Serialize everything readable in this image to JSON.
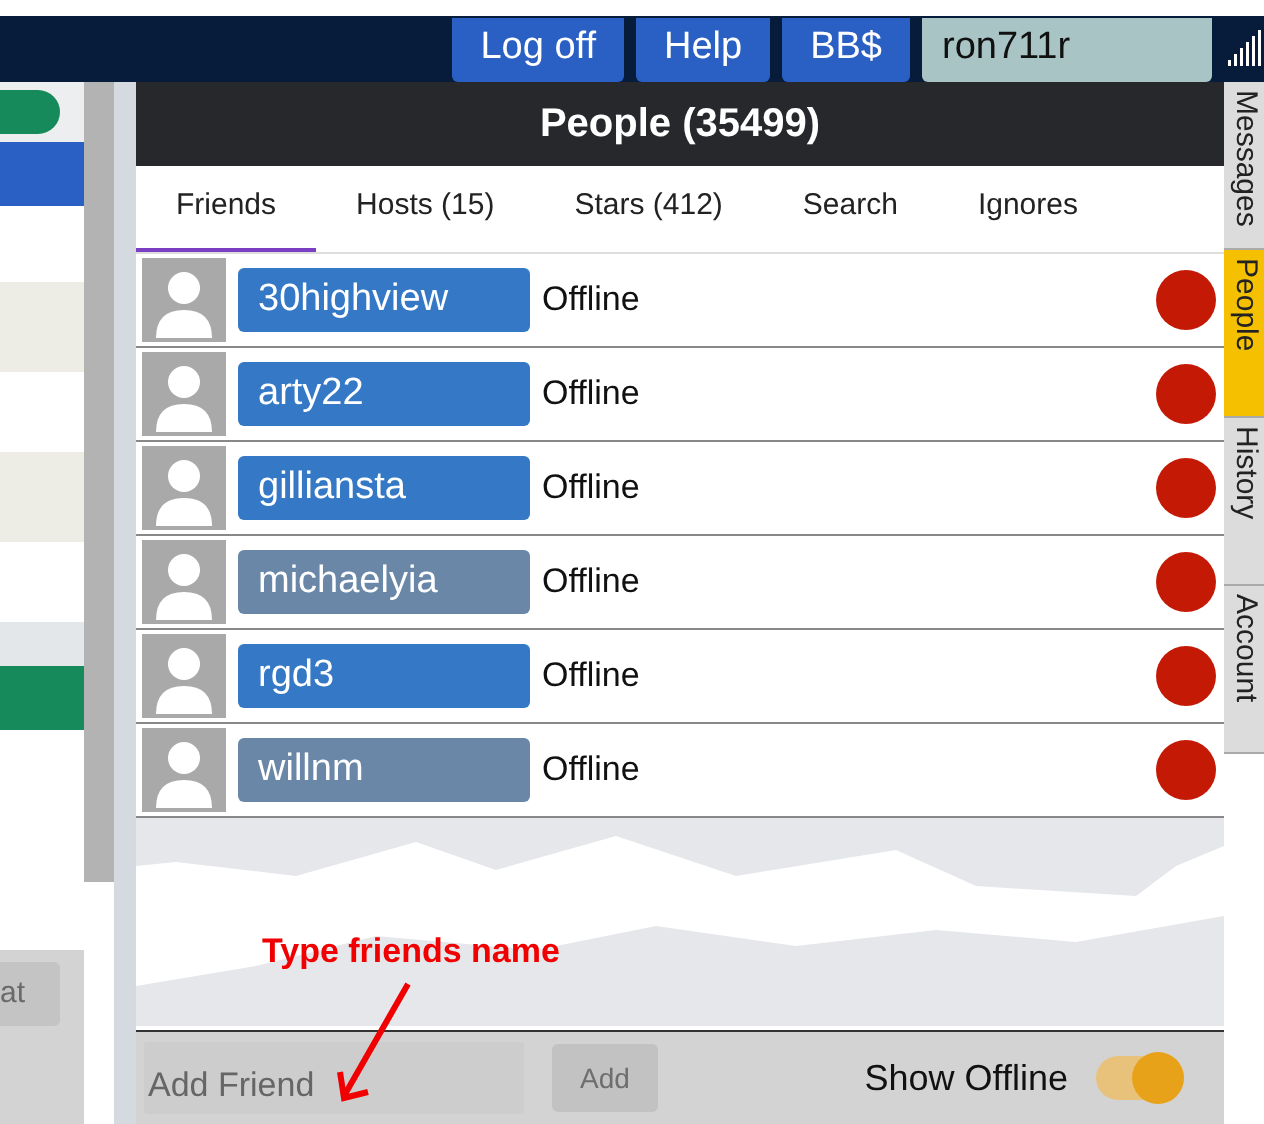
{
  "top_bar": {
    "buttons": [
      "Log off",
      "Help",
      "BB$"
    ],
    "username": "ron711r"
  },
  "panel": {
    "title": "People (35499)",
    "tabs": [
      {
        "label": "Friends",
        "selected": true
      },
      {
        "label": "Hosts (15)",
        "selected": false
      },
      {
        "label": "Stars (412)",
        "selected": false
      },
      {
        "label": "Search",
        "selected": false
      },
      {
        "label": "Ignores",
        "selected": false
      }
    ],
    "friends": [
      {
        "name": "30highview",
        "status": "Offline",
        "color": "#3478c6"
      },
      {
        "name": "arty22",
        "status": "Offline",
        "color": "#3478c6"
      },
      {
        "name": "gilliansta",
        "status": "Offline",
        "color": "#3478c6"
      },
      {
        "name": "michaelyia",
        "status": "Offline",
        "color": "#6a87a8"
      },
      {
        "name": "rgd3",
        "status": "Offline",
        "color": "#3478c6"
      },
      {
        "name": "willnm",
        "status": "Offline",
        "color": "#6a87a8"
      }
    ],
    "add_friend": {
      "placeholder": "Add Friend",
      "button": "Add",
      "button_disabled": true
    },
    "show_offline": {
      "label": "Show Offline",
      "on": true
    }
  },
  "side_tabs": [
    {
      "label": "Messages",
      "selected": false
    },
    {
      "label": "People",
      "selected": true
    },
    {
      "label": "History",
      "selected": false
    },
    {
      "label": "Account",
      "selected": false
    }
  ],
  "left_button": "at",
  "annotation": "Type friends name"
}
